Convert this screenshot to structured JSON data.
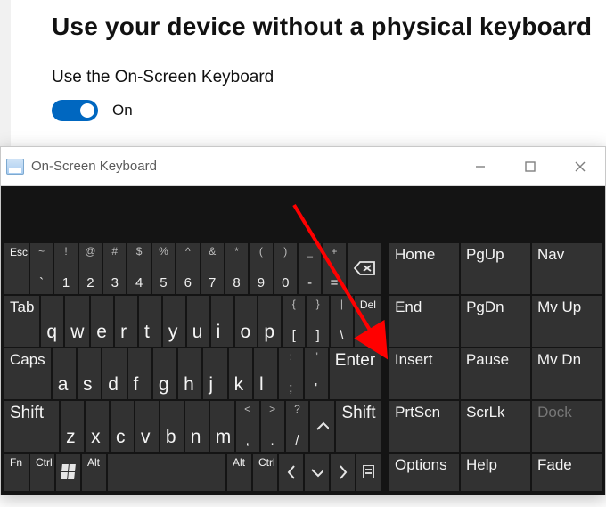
{
  "settings": {
    "title": "Use your device without a physical keyboard",
    "subtitle": "Use the On-Screen Keyboard",
    "toggle_state_label": "On"
  },
  "osk_window": {
    "title": "On-Screen Keyboard"
  },
  "keys": {
    "esc": "Esc",
    "tilde_u": "~",
    "tilde_l": "`",
    "n1_u": "!",
    "n1_l": "1",
    "n2_u": "@",
    "n2_l": "2",
    "n3_u": "#",
    "n3_l": "3",
    "n4_u": "$",
    "n4_l": "4",
    "n5_u": "%",
    "n5_l": "5",
    "n6_u": "^",
    "n6_l": "6",
    "n7_u": "&",
    "n7_l": "7",
    "n8_u": "*",
    "n8_l": "8",
    "n9_u": "(",
    "n9_l": "9",
    "n0_u": ")",
    "n0_l": "0",
    "minus_u": "_",
    "minus_l": "-",
    "equal_u": "+",
    "equal_l": "=",
    "tab": "Tab",
    "q": "q",
    "w": "w",
    "e": "e",
    "r": "r",
    "t": "t",
    "y": "y",
    "u": "u",
    "i": "i",
    "o": "o",
    "p": "p",
    "lbr_u": "{",
    "lbr_l": "[",
    "rbr_u": "}",
    "rbr_l": "]",
    "bslash_u": "|",
    "bslash_l": "\\",
    "del": "Del",
    "caps": "Caps",
    "a": "a",
    "s": "s",
    "d": "d",
    "f": "f",
    "g": "g",
    "h": "h",
    "j": "j",
    "k": "k",
    "l": "l",
    "semi_u": ":",
    "semi_l": ";",
    "quote_u": "\"",
    "quote_l": "'",
    "enter": "Enter",
    "shift_l": "Shift",
    "shift_r": "Shift",
    "z": "z",
    "x": "x",
    "c": "c",
    "v": "v",
    "b": "b",
    "n": "n",
    "m": "m",
    "comma_u": "<",
    "comma_l": ",",
    "period_u": ">",
    "period_l": ".",
    "slash_u": "?",
    "slash_l": "/",
    "up": "︿",
    "fn": "Fn",
    "ctrl": "Ctrl",
    "alt": "Alt",
    "left": "〈",
    "down": "﹀",
    "right": "〉",
    "home": "Home",
    "pgup": "PgUp",
    "nav": "Nav",
    "end": "End",
    "pgdn": "PgDn",
    "mvup": "Mv Up",
    "insert": "Insert",
    "pause": "Pause",
    "mvdn": "Mv Dn",
    "prtscn": "PrtScn",
    "scrlk": "ScrLk",
    "dock": "Dock",
    "options": "Options",
    "help": "Help",
    "fade": "Fade"
  }
}
